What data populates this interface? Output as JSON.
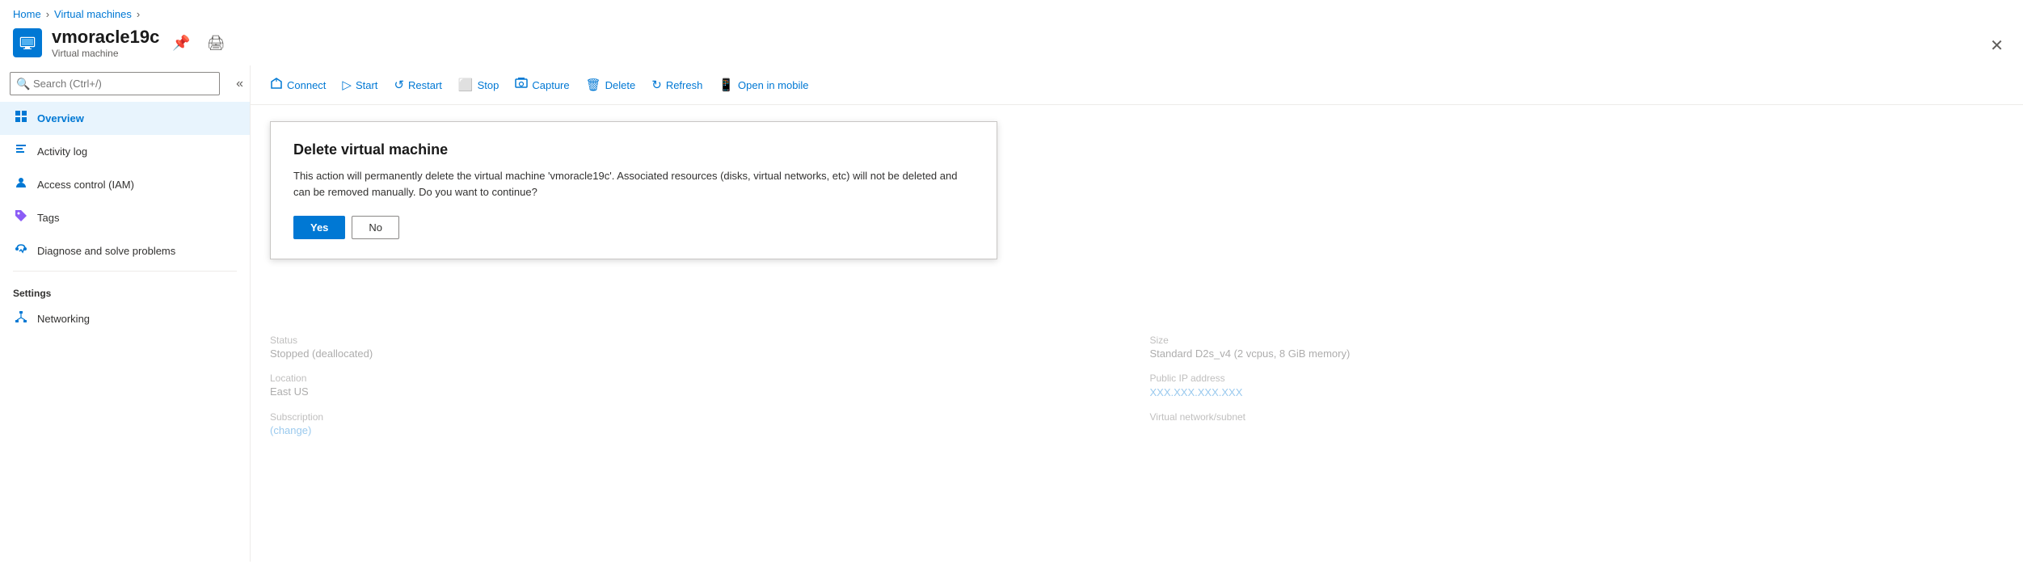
{
  "breadcrumb": {
    "home": "Home",
    "vms": "Virtual machines",
    "separator": "›"
  },
  "header": {
    "title": "vmoracle19c",
    "subtitle": "Virtual machine",
    "pin_icon": "📌",
    "print_icon": "🖨",
    "close_icon": "✕"
  },
  "search": {
    "placeholder": "Search (Ctrl+/)"
  },
  "toolbar": {
    "connect": "Connect",
    "start": "Start",
    "restart": "Restart",
    "stop": "Stop",
    "capture": "Capture",
    "delete": "Delete",
    "refresh": "Refresh",
    "open_in_mobile": "Open in mobile"
  },
  "sidebar": {
    "items": [
      {
        "id": "overview",
        "label": "Overview",
        "icon": "⬛",
        "active": true
      },
      {
        "id": "activity-log",
        "label": "Activity log",
        "icon": "📋",
        "active": false
      },
      {
        "id": "access-control",
        "label": "Access control (IAM)",
        "icon": "👥",
        "active": false
      },
      {
        "id": "tags",
        "label": "Tags",
        "icon": "🏷",
        "active": false
      },
      {
        "id": "diagnose",
        "label": "Diagnose and solve problems",
        "icon": "🔧",
        "active": false
      }
    ],
    "settings_section": "Settings",
    "settings_items": [
      {
        "id": "networking",
        "label": "Networking",
        "icon": "🌐",
        "active": false
      }
    ]
  },
  "dialog": {
    "title": "Delete virtual machine",
    "message": "This action will permanently delete the virtual machine 'vmoracle19c'. Associated resources (disks, virtual networks, etc) will not be deleted and can be removed manually. Do you want to continue?",
    "yes_label": "Yes",
    "no_label": "No"
  },
  "info": {
    "status_label": "Status",
    "status_value": "Stopped (deallocated)",
    "location_label": "Location",
    "location_value": "East US",
    "subscription_label": "Subscription",
    "subscription_change": "(change)",
    "size_label": "Size",
    "size_value": "Standard D2s_v4 (2 vcpus, 8 GiB memory)",
    "public_ip_label": "Public IP address",
    "public_ip_value": "XXX.XXX.XXX.XXX",
    "vnet_label": "Virtual network/subnet"
  }
}
